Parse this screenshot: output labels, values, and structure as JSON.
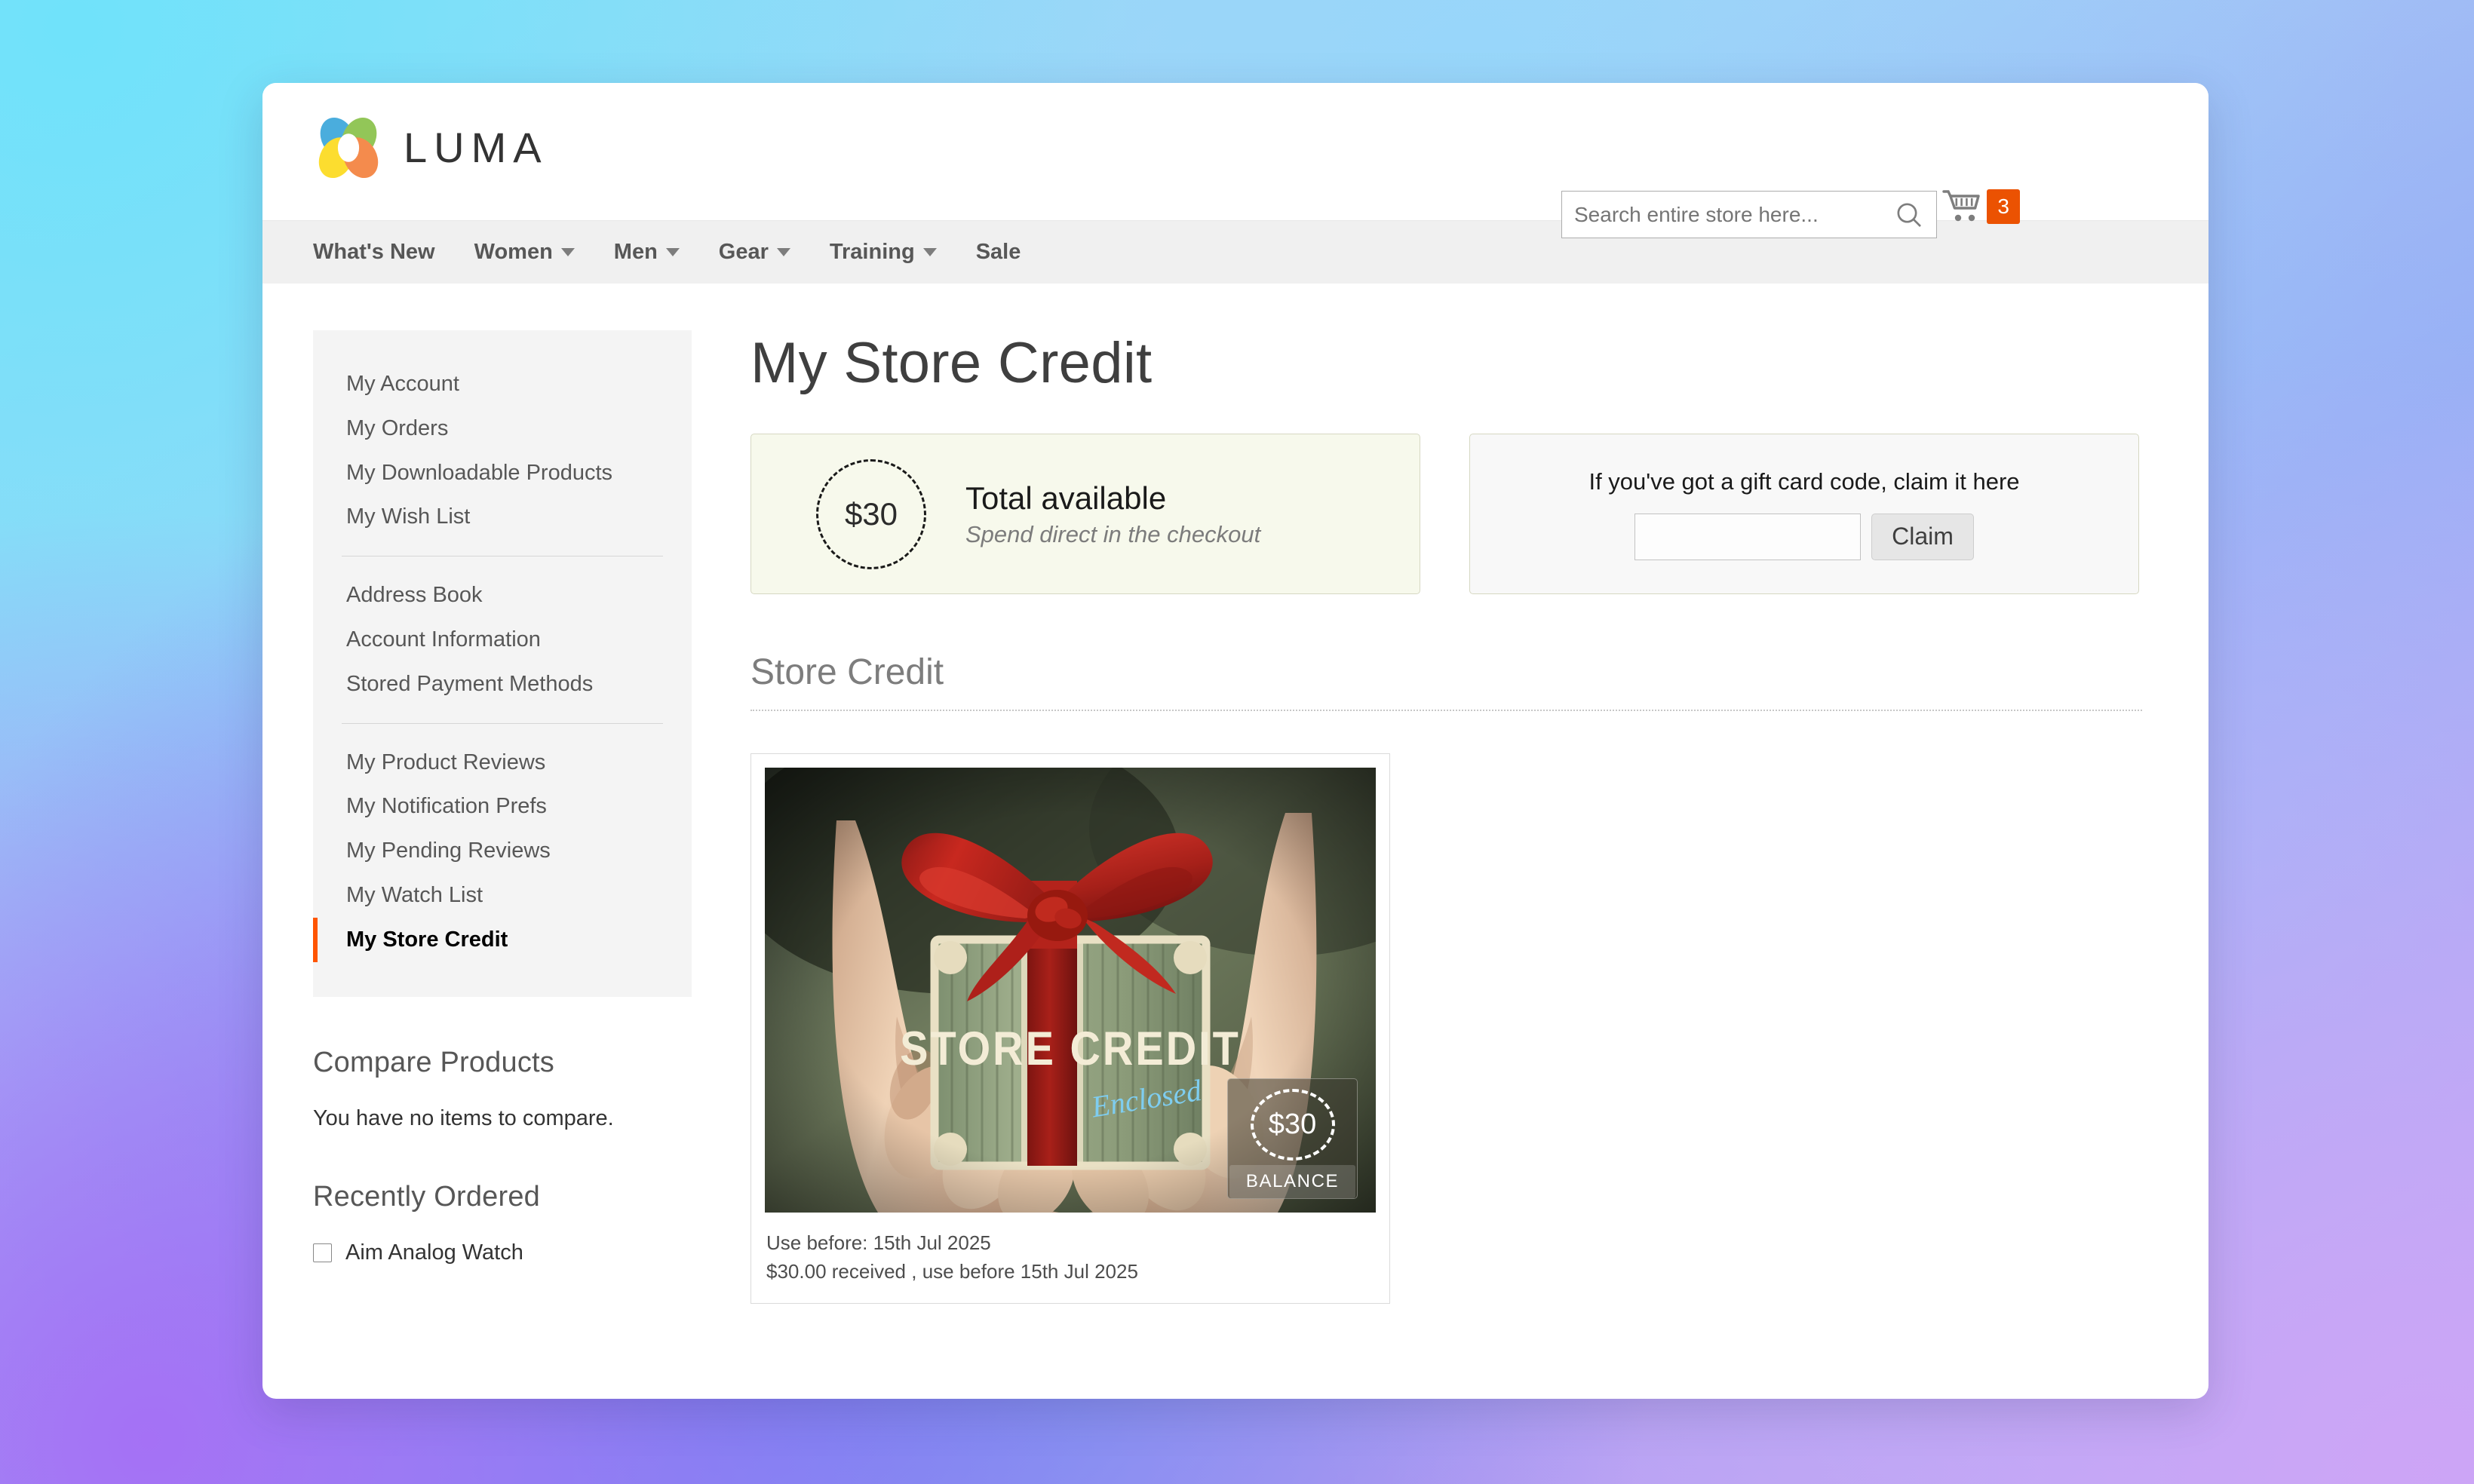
{
  "header": {
    "logo_text": "LUMA",
    "search": {
      "placeholder": "Search entire store here...",
      "value": ""
    },
    "cart": {
      "count": "3"
    }
  },
  "nav": {
    "items": [
      {
        "label": "What's New",
        "has_dropdown": false
      },
      {
        "label": "Women",
        "has_dropdown": true
      },
      {
        "label": "Men",
        "has_dropdown": true
      },
      {
        "label": "Gear",
        "has_dropdown": true
      },
      {
        "label": "Training",
        "has_dropdown": true
      },
      {
        "label": "Sale",
        "has_dropdown": false
      }
    ]
  },
  "sidebar": {
    "group1": [
      "My Account",
      "My Orders",
      "My Downloadable Products",
      "My Wish List"
    ],
    "group2": [
      "Address Book",
      "Account Information",
      "Stored Payment Methods"
    ],
    "group3": [
      "My Product Reviews",
      "My Notification Prefs",
      "My Pending Reviews",
      "My Watch List",
      "My Store Credit"
    ],
    "active_item": "My Store Credit",
    "compare": {
      "heading": "Compare Products",
      "empty_message": "You have no items to compare."
    },
    "recently_ordered": {
      "heading": "Recently Ordered",
      "items": [
        {
          "label": "Aim Analog Watch",
          "checked": false
        }
      ]
    }
  },
  "main": {
    "page_title": "My Store Credit",
    "balance_panel": {
      "amount": "$30",
      "title": "Total available",
      "subtitle": "Spend direct in the checkout"
    },
    "claim_panel": {
      "label": "If you've got a gift card code, claim it here",
      "input_value": "",
      "button_label": "Claim"
    },
    "section_heading": "Store Credit",
    "credit_item": {
      "image_caption_title": "STORE CREDIT",
      "image_caption_script": "Enclosed",
      "overlay_amount": "$30",
      "overlay_label": "BALANCE",
      "use_before": "Use before: 15th Jul 2025",
      "received_line": "$30.00 received , use before 15th Jul 2025"
    }
  },
  "colors": {
    "accent_orange": "#ff5501",
    "cart_badge": "#eb5202",
    "balance_panel_bg": "#f7f9ec",
    "claim_panel_bg": "#f8f8f8",
    "sidebar_bg": "#f4f4f4"
  }
}
